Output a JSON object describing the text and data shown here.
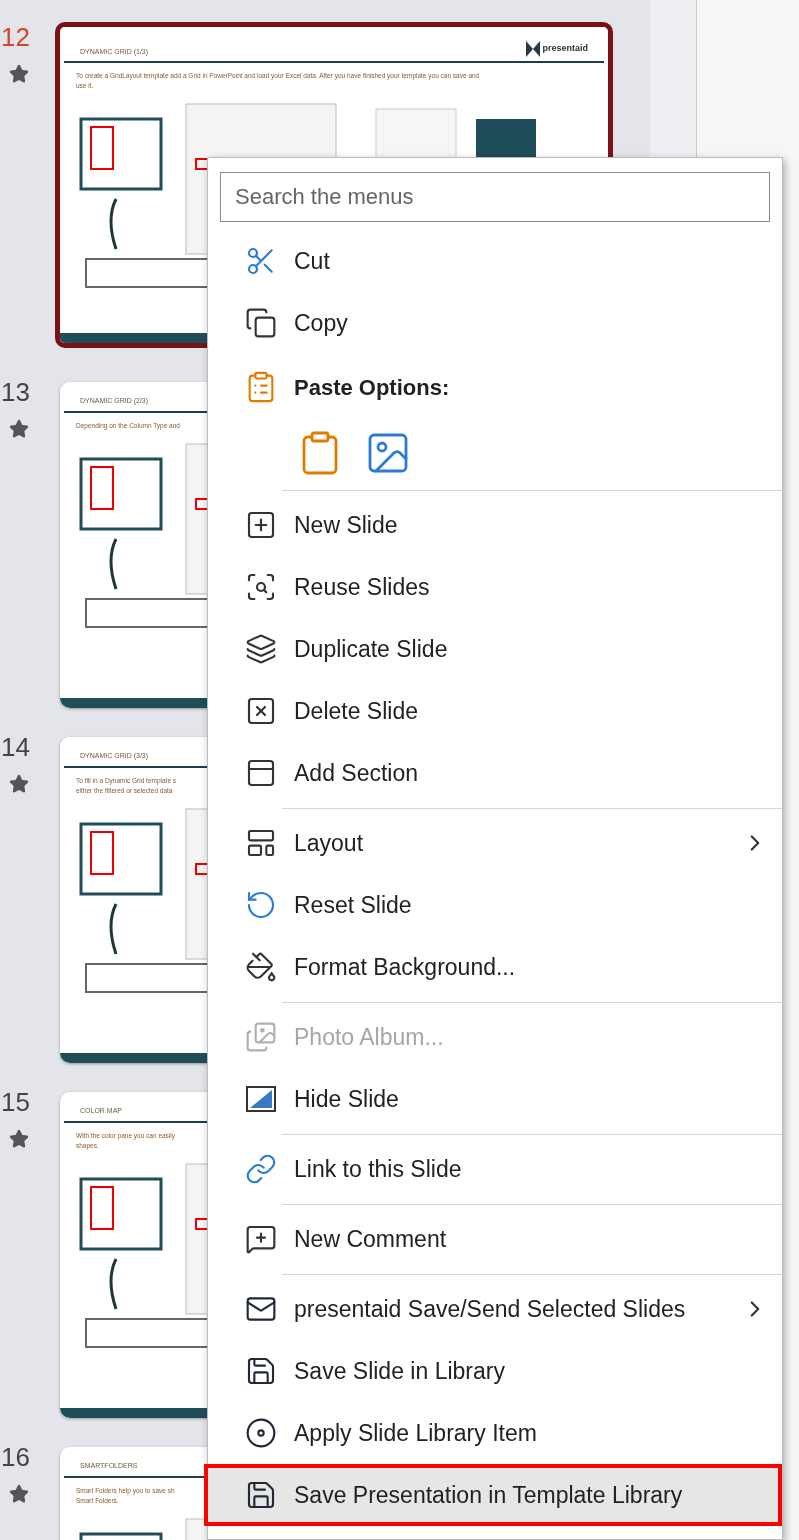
{
  "slides": [
    {
      "number": "12",
      "selected": true,
      "title": "DYNAMIC GRID (1/3)",
      "logo": "presentaid",
      "body_lines": [
        "To create a GridLayout template add a Grid in PowerPoint and load your Excel data. After you have finished your template you can save and",
        "use it."
      ]
    },
    {
      "number": "13",
      "selected": false,
      "title": "DYNAMIC GRID (2/3)",
      "body_lines": [
        "Depending on the Column Type and"
      ]
    },
    {
      "number": "14",
      "selected": false,
      "title": "DYNAMIC GRID (3/3)",
      "body_lines": [
        "To fill in a Dynamic Grid template s",
        "either the filtered or selected data"
      ]
    },
    {
      "number": "15",
      "selected": false,
      "title": "COLOR MAP",
      "body_lines": [
        "With the color pane you can easily",
        "shapes."
      ]
    },
    {
      "number": "16",
      "selected": false,
      "title": "SMARTFOLDERS",
      "body_lines": [
        "Smart Folders help you to save sh",
        "Smart Folders."
      ]
    }
  ],
  "context_menu": {
    "search": {
      "placeholder": "Search the menus"
    },
    "items": [
      {
        "kind": "command",
        "label": "Cut",
        "selected": false,
        "disabled": false,
        "submenu": false,
        "outlined": false
      },
      {
        "kind": "command",
        "label": "Copy",
        "selected": false,
        "disabled": false,
        "submenu": false,
        "outlined": false
      },
      {
        "kind": "header",
        "label": "Paste Options:"
      },
      {
        "kind": "paste_options"
      },
      {
        "kind": "separator"
      },
      {
        "kind": "command",
        "label": "New Slide",
        "selected": false,
        "disabled": false,
        "submenu": false,
        "outlined": false
      },
      {
        "kind": "command",
        "label": "Reuse Slides",
        "selected": false,
        "disabled": false,
        "submenu": false,
        "outlined": false
      },
      {
        "kind": "command",
        "label": "Duplicate Slide",
        "selected": false,
        "disabled": false,
        "submenu": false,
        "outlined": false
      },
      {
        "kind": "command",
        "label": "Delete Slide",
        "selected": false,
        "disabled": false,
        "submenu": false,
        "outlined": false
      },
      {
        "kind": "command",
        "label": "Add Section",
        "selected": false,
        "disabled": false,
        "submenu": false,
        "outlined": false
      },
      {
        "kind": "separator"
      },
      {
        "kind": "command",
        "label": "Layout",
        "selected": false,
        "disabled": false,
        "submenu": true,
        "outlined": false
      },
      {
        "kind": "command",
        "label": "Reset Slide",
        "selected": false,
        "disabled": false,
        "submenu": false,
        "outlined": false
      },
      {
        "kind": "command",
        "label": "Format Background...",
        "selected": false,
        "disabled": false,
        "submenu": false,
        "outlined": false
      },
      {
        "kind": "separator"
      },
      {
        "kind": "command",
        "label": "Photo Album...",
        "selected": false,
        "disabled": true,
        "submenu": false,
        "outlined": false
      },
      {
        "kind": "command",
        "label": "Hide Slide",
        "selected": false,
        "disabled": false,
        "submenu": false,
        "outlined": false
      },
      {
        "kind": "separator"
      },
      {
        "kind": "command",
        "label": "Link to this Slide",
        "selected": false,
        "disabled": false,
        "submenu": false,
        "outlined": false
      },
      {
        "kind": "separator"
      },
      {
        "kind": "command",
        "label": "New Comment",
        "selected": false,
        "disabled": false,
        "submenu": false,
        "outlined": false
      },
      {
        "kind": "separator"
      },
      {
        "kind": "command",
        "label": "presentaid Save/Send Selected Slides",
        "selected": false,
        "disabled": false,
        "submenu": true,
        "outlined": false
      },
      {
        "kind": "command",
        "label": "Save Slide in Library",
        "selected": false,
        "disabled": false,
        "submenu": false,
        "outlined": false
      },
      {
        "kind": "command",
        "label": "Apply Slide Library Item",
        "selected": false,
        "disabled": false,
        "submenu": false,
        "outlined": false
      },
      {
        "kind": "command",
        "label": "Save Presentation in Template Library",
        "selected": true,
        "disabled": false,
        "submenu": false,
        "outlined": true
      }
    ]
  }
}
